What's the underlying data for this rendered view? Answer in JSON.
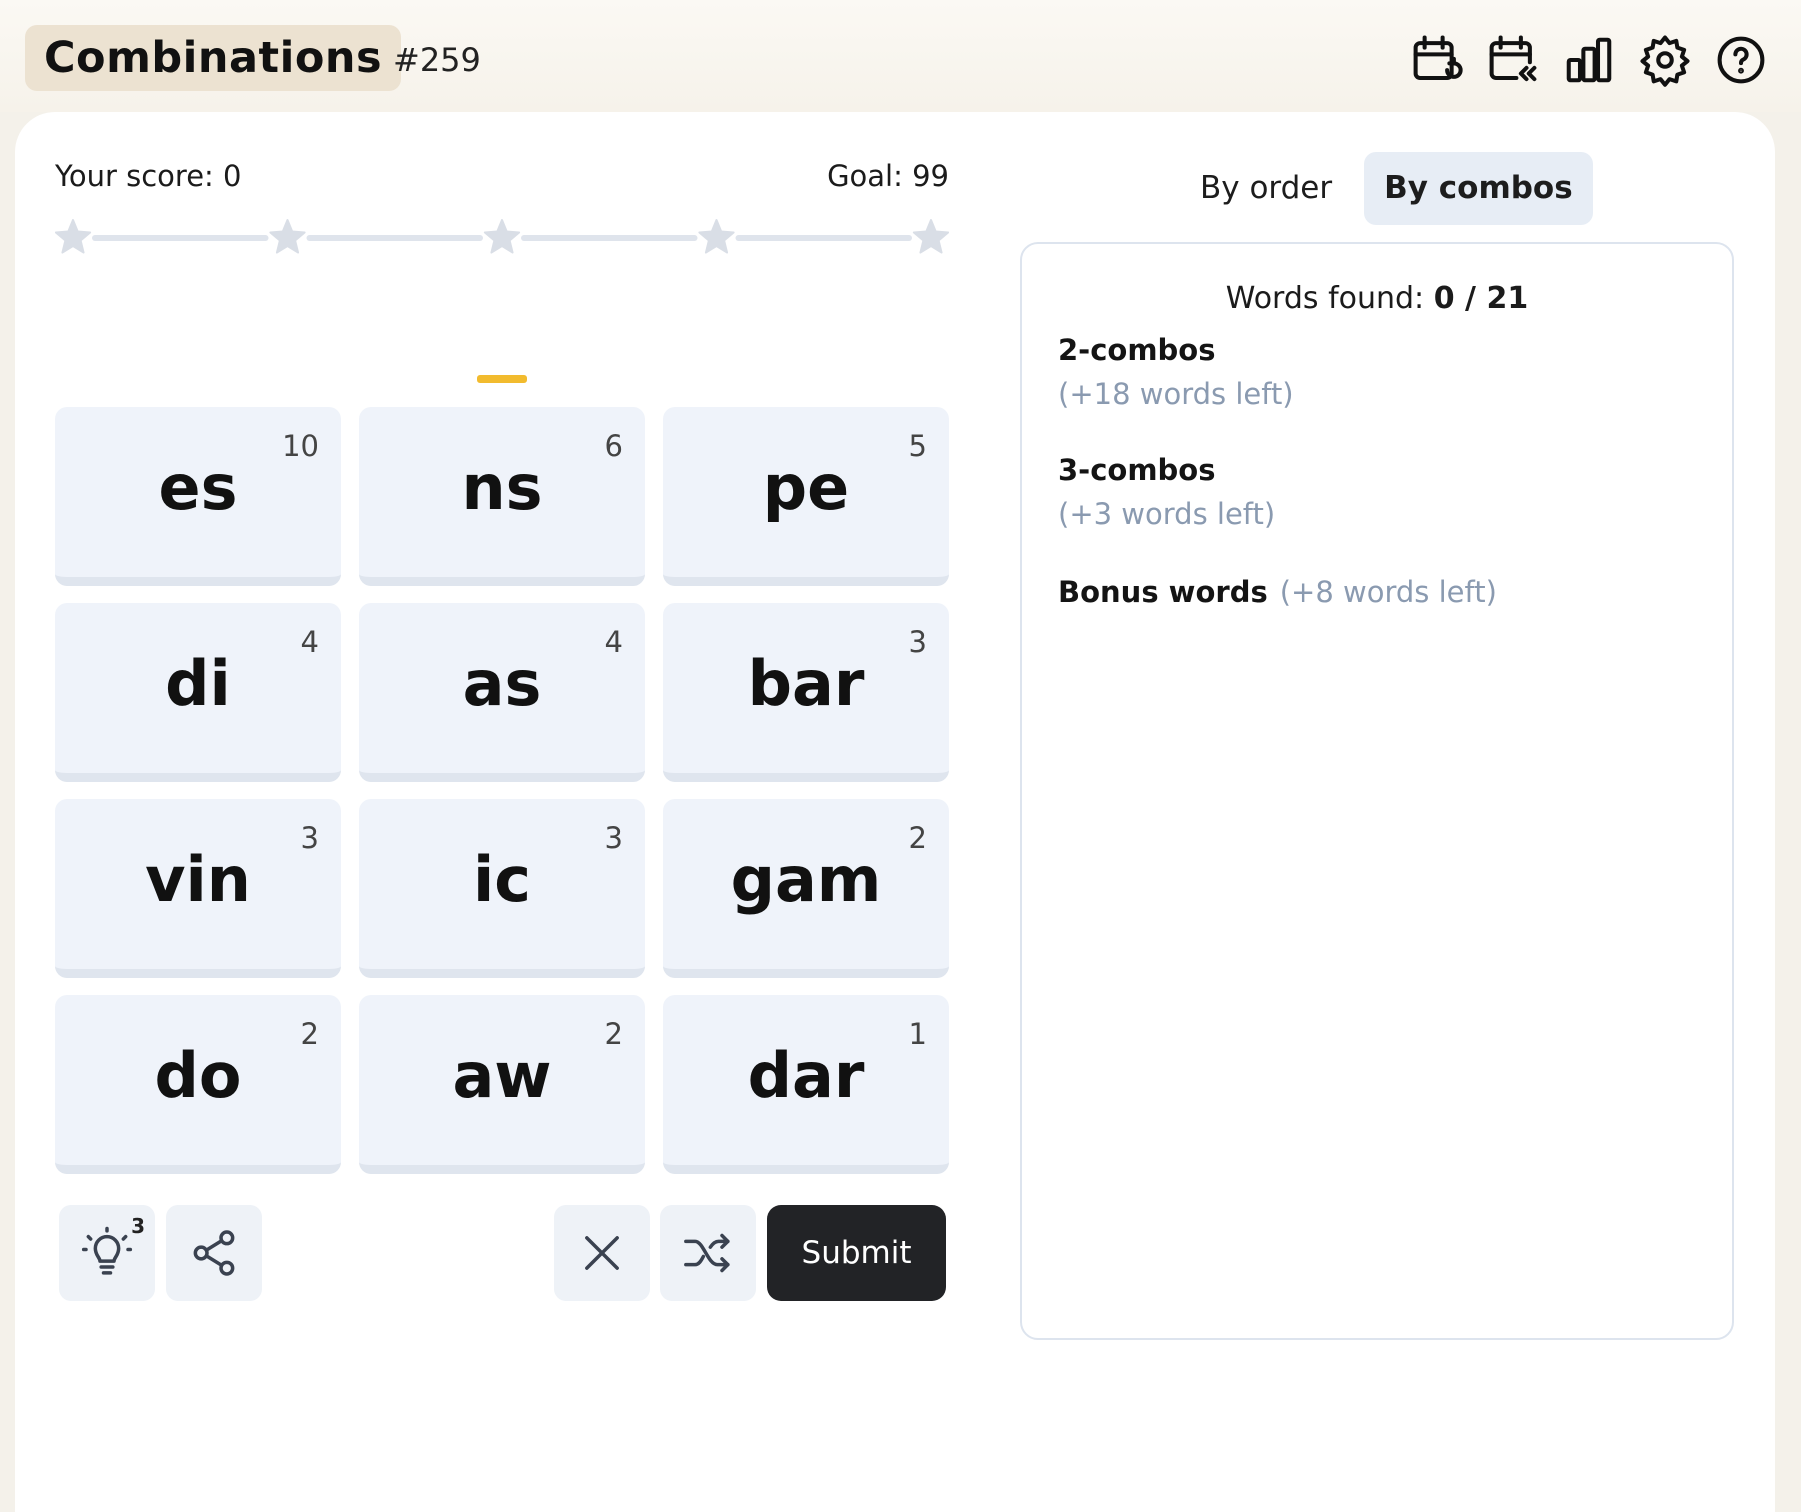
{
  "header": {
    "title": "Combinations",
    "puzzle_number": "#259",
    "icons": [
      "calendar-refresh-icon",
      "calendar-rewind-icon",
      "stats-icon",
      "settings-icon",
      "help-icon"
    ]
  },
  "game": {
    "score_text": "Your score: 0",
    "goal_text": "Goal: 99",
    "score": 0,
    "goal": 99,
    "progress_stars": 5,
    "tiles": [
      {
        "text": "es",
        "count": "10"
      },
      {
        "text": "ns",
        "count": "6"
      },
      {
        "text": "pe",
        "count": "5"
      },
      {
        "text": "di",
        "count": "4"
      },
      {
        "text": "as",
        "count": "4"
      },
      {
        "text": "bar",
        "count": "3"
      },
      {
        "text": "vin",
        "count": "3"
      },
      {
        "text": "ic",
        "count": "3"
      },
      {
        "text": "gam",
        "count": "2"
      },
      {
        "text": "do",
        "count": "2"
      },
      {
        "text": "aw",
        "count": "2"
      },
      {
        "text": "dar",
        "count": "1"
      }
    ],
    "controls": {
      "hint_count": "3",
      "submit_label": "Submit"
    }
  },
  "words_panel": {
    "tabs": [
      {
        "label": "By order",
        "active": false
      },
      {
        "label": "By combos",
        "active": true
      }
    ],
    "found_label": "Words found:",
    "found_value": "0 / 21",
    "groups": [
      {
        "title": "2-combos",
        "left": "(+18 words left)"
      },
      {
        "title": "3-combos",
        "left": "(+3 words left)"
      },
      {
        "title": "Bonus words",
        "left": "(+8 words left)"
      }
    ]
  },
  "colors": {
    "accent_caret": "#f2bb2e",
    "tile_bg": "#eff3fa",
    "submit_bg": "#222326",
    "muted_text": "#8a9ab0"
  }
}
